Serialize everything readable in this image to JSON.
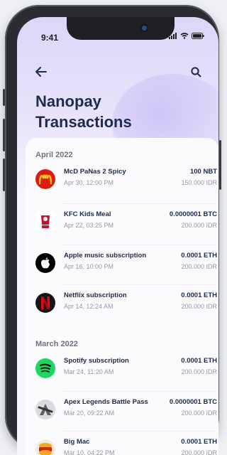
{
  "status": {
    "time": "9:41"
  },
  "header": {
    "title_line1": "Nanopay",
    "title_line2": "Transactions"
  },
  "icons": {
    "back": "arrow-left-icon",
    "search": "search-icon"
  },
  "sections": [
    {
      "label": "April 2022",
      "items": [
        {
          "name": "McD PaNas 2 Spicy",
          "date": "Apr 30, 12:00 PM",
          "amount": "100 NBT",
          "idr": "150.000 IDR",
          "logo": "mcdonalds-logo"
        },
        {
          "name": "KFC Kids Meal",
          "date": "Apr 22, 03:25 PM",
          "amount": "0.0000001 BTC",
          "idr": "200.000 IDR",
          "logo": "kfc-logo"
        },
        {
          "name": "Apple music subscription",
          "date": "Apr 16, 10:00 PM",
          "amount": "0.0001 ETH",
          "idr": "200.000 IDR",
          "logo": "apple-logo"
        },
        {
          "name": "Netflix subscription",
          "date": "Apr 14, 12:24 AM",
          "amount": "0.0001 ETH",
          "idr": "200.000 IDR",
          "logo": "netflix-logo"
        }
      ]
    },
    {
      "label": "March 2022",
      "items": [
        {
          "name": "Spotify subscription",
          "date": "Mar 24, 11:20 AM",
          "amount": "0.0001 ETH",
          "idr": "200.000 IDR",
          "logo": "spotify-logo"
        },
        {
          "name": "Apex Legends Battle Pass",
          "date": "Mar 20, 09:22 AM",
          "amount": "0.0000001 BTC",
          "idr": "200.000 IDR",
          "logo": "apex-legends-logo"
        },
        {
          "name": "Big Mac",
          "date": "Mar 10, 04:22 PM",
          "amount": "0.0001 ETH",
          "idr": "200.000 IDR",
          "logo": "burger-king-logo"
        }
      ]
    }
  ]
}
